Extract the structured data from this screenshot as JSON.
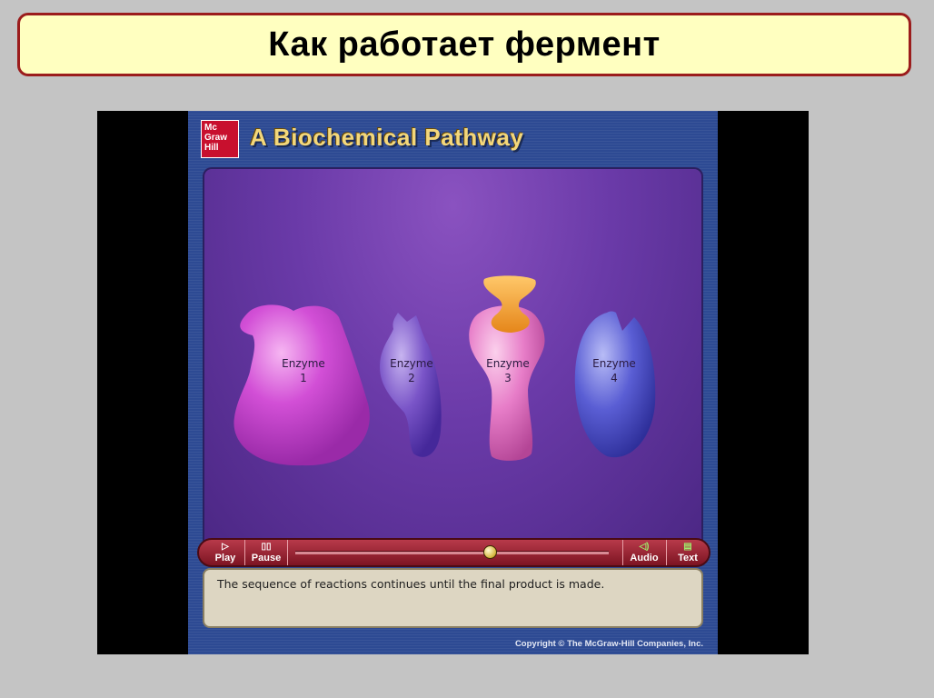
{
  "slide": {
    "title": "Как работает фермент"
  },
  "animation": {
    "logo_lines": [
      "Mc",
      "Graw",
      "Hill"
    ],
    "title": "A Biochemical Pathway",
    "enzymes": [
      {
        "name": "Enzyme",
        "number": "1",
        "color": "#d24fd6"
      },
      {
        "name": "Enzyme",
        "number": "2",
        "color": "#7a55c8"
      },
      {
        "name": "Enzyme",
        "number": "3",
        "color": "#e77dc8"
      },
      {
        "name": "Enzyme",
        "number": "4",
        "color": "#5a5ed4"
      }
    ],
    "substrate_color": "#f4a53a",
    "controls": {
      "play": {
        "icon": "▷",
        "label": "Play"
      },
      "pause": {
        "icon": "▯▯",
        "label": "Pause"
      },
      "audio": {
        "icon": "◁)",
        "label": "Audio"
      },
      "text": {
        "icon": "▤",
        "label": "Text"
      },
      "progress": 0.62
    },
    "caption": "The sequence of reactions continues until the final product is made.",
    "copyright": "Copyright © The McGraw-Hill Companies, Inc."
  },
  "colors": {
    "banner_bg": "#ffffc0",
    "banner_border": "#9b1c1c",
    "stage_bg": "#2d4a93",
    "control_bar": "#9a2030"
  }
}
